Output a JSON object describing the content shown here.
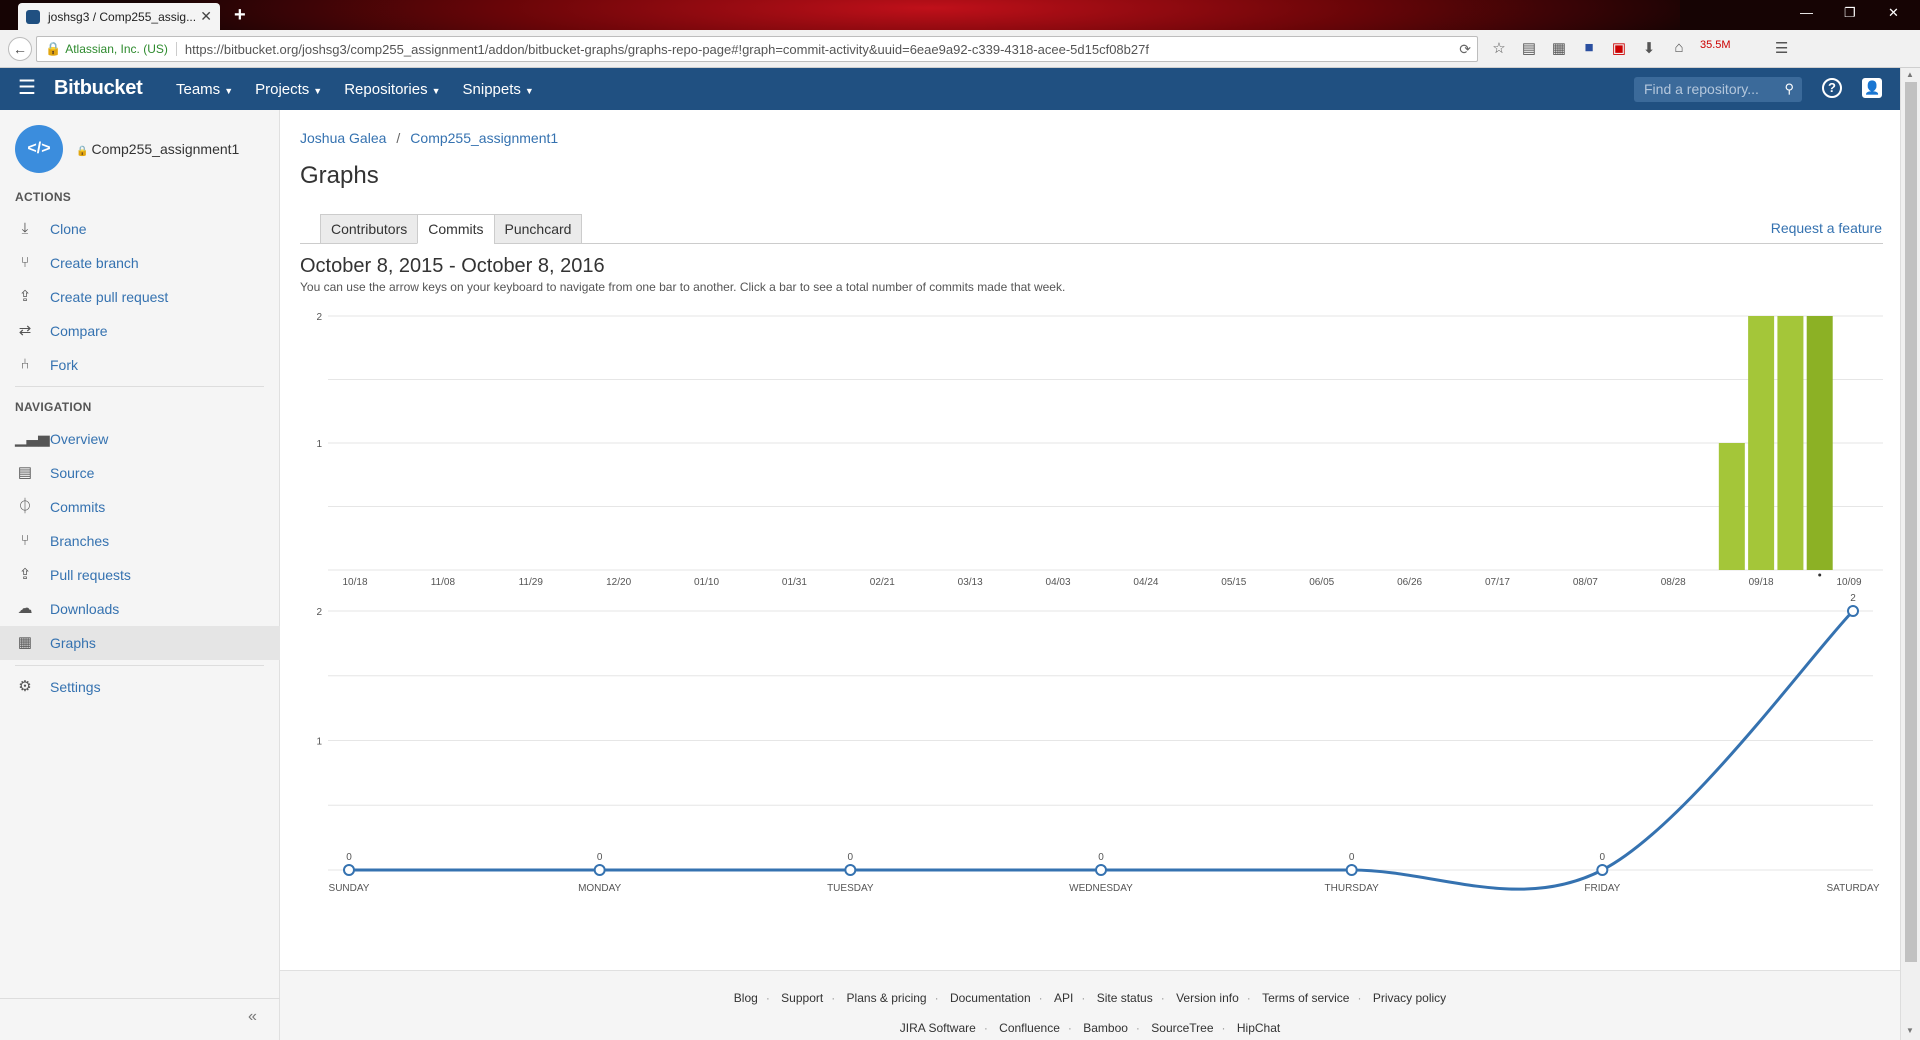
{
  "browser": {
    "tab_title": "joshsg3 / Comp255_assig...",
    "org": "Atlassian, Inc. (US)",
    "url": "https://bitbucket.org/joshsg3/comp255_assignment1/addon/bitbucket-graphs/graphs-repo-page#!graph=commit-activity&uuid=6eae9a92-c339-4318-acee-5d15cf08b27f",
    "badge": "35.5M"
  },
  "header": {
    "logo": "Bitbucket",
    "nav": [
      "Teams",
      "Projects",
      "Repositories",
      "Snippets"
    ],
    "search_placeholder": "Find a repository..."
  },
  "sidebar": {
    "repo_name": "Comp255_assignment1",
    "actions_heading": "ACTIONS",
    "actions": [
      {
        "label": "Clone",
        "icon": "download-icon"
      },
      {
        "label": "Create branch",
        "icon": "branch-icon"
      },
      {
        "label": "Create pull request",
        "icon": "pull-request-icon"
      },
      {
        "label": "Compare",
        "icon": "compare-icon"
      },
      {
        "label": "Fork",
        "icon": "fork-icon"
      }
    ],
    "navigation_heading": "NAVIGATION",
    "navigation": [
      {
        "label": "Overview",
        "icon": "overview-icon"
      },
      {
        "label": "Source",
        "icon": "source-icon"
      },
      {
        "label": "Commits",
        "icon": "commits-icon"
      },
      {
        "label": "Branches",
        "icon": "branches-icon"
      },
      {
        "label": "Pull requests",
        "icon": "pull-requests-icon"
      },
      {
        "label": "Downloads",
        "icon": "downloads-icon"
      },
      {
        "label": "Graphs",
        "icon": "graphs-icon"
      }
    ],
    "settings": "Settings"
  },
  "main": {
    "breadcrumb": [
      "Joshua Galea",
      "Comp255_assignment1"
    ],
    "title": "Graphs",
    "tabs": [
      "Contributors",
      "Commits",
      "Punchcard"
    ],
    "active_tab": "Commits",
    "request_feature": "Request a feature",
    "date_range": "October 8, 2015 - October 8, 2016",
    "hint": "You can use the arrow keys on your keyboard to navigate from one bar to another. Click a bar to see a total number of commits made that week."
  },
  "chart_data": [
    {
      "type": "bar",
      "x_tick_labels": [
        "10/18",
        "11/08",
        "11/29",
        "12/20",
        "01/10",
        "01/31",
        "02/21",
        "03/13",
        "04/03",
        "04/24",
        "05/15",
        "06/05",
        "06/26",
        "07/17",
        "08/07",
        "08/28",
        "09/18",
        "10/09"
      ],
      "x": [
        "09/11",
        "09/18",
        "09/25",
        "10/02"
      ],
      "values": [
        1,
        2,
        2,
        2
      ],
      "ylim": [
        0,
        2
      ],
      "y_ticks": [
        1,
        2
      ],
      "grid": true,
      "colors": [
        "#a4c639",
        "#a4c639",
        "#a4c639",
        "#8cb125"
      ]
    },
    {
      "type": "line",
      "categories": [
        "SUNDAY",
        "MONDAY",
        "TUESDAY",
        "WEDNESDAY",
        "THURSDAY",
        "FRIDAY",
        "SATURDAY"
      ],
      "values": [
        0,
        0,
        0,
        0,
        0,
        0,
        2
      ],
      "ylim": [
        0,
        2
      ],
      "y_ticks": [
        1,
        2
      ],
      "grid": true,
      "color": "#3572b0"
    }
  ],
  "footer": {
    "links": [
      "Blog",
      "Support",
      "Plans & pricing",
      "Documentation",
      "API",
      "Site status",
      "Version info",
      "Terms of service",
      "Privacy policy"
    ],
    "products": [
      "JIRA Software",
      "Confluence",
      "Bamboo",
      "SourceTree",
      "HipChat"
    ]
  }
}
